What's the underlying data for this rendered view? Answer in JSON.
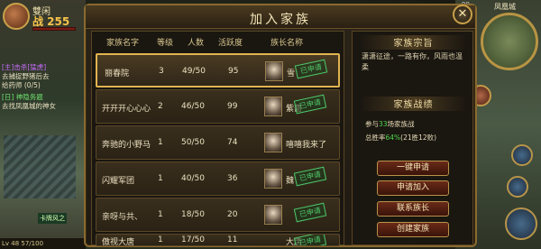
{
  "hud": {
    "player_name": "雙闲",
    "power": "战 255",
    "quests": [
      {
        "line1": "[主]击杀[猛虎]",
        "line2": "去捕捉野猪后去",
        "line3": "给药师 (0/5)"
      },
      {
        "line1": "[日] 神隐务题",
        "line2": "去找凤凰城的神女",
        "line3": ""
      }
    ],
    "bottom_tag": "卡牌风之",
    "level_text": "Lv 48  57/100"
  },
  "map": {
    "name": "凤凰城",
    "top_stat": "99"
  },
  "dialog": {
    "title": "加入家族",
    "close_label": "✕",
    "table": {
      "headers": [
        "家族名字",
        "等级",
        "人数",
        "活跃度",
        "族长名称"
      ],
      "rows": [
        {
          "name": "丽春院",
          "level": "3",
          "members": "49/50",
          "activity": "95",
          "leader": "雪",
          "applied": "已申请",
          "selected": true
        },
        {
          "name": "开开开心心心",
          "level": "2",
          "members": "46/50",
          "activity": "99",
          "leader": "紫蔷",
          "applied": "已申请",
          "selected": false
        },
        {
          "name": "奔驰的小野马",
          "level": "1",
          "members": "50/50",
          "activity": "74",
          "leader": "嘻嘻我来了",
          "applied": "",
          "selected": false
        },
        {
          "name": "闪耀军团",
          "level": "1",
          "members": "40/50",
          "activity": "36",
          "leader": "魏",
          "applied": "已申请",
          "selected": false
        },
        {
          "name": "亲呀与共、",
          "level": "1",
          "members": "18/50",
          "activity": "20",
          "leader": "",
          "applied": "已申请",
          "selected": false
        },
        {
          "name": "傲视大唐",
          "level": "1",
          "members": "17/50",
          "activity": "11",
          "leader": "大唐",
          "applied": "已申请",
          "selected": false
        }
      ]
    },
    "info": {
      "purpose_title": "家族宗旨",
      "purpose_text": "潇潇征途，一路有你，风雨也温柔",
      "war_title": "家族战绩",
      "war_line1_pre": "参与",
      "war_line1_num": "33",
      "war_line1_post": "场家族战",
      "war_line2_pre": "总胜率",
      "war_line2_num": "64%",
      "war_line2_post": "(21胜12败)"
    },
    "buttons": {
      "quick_apply": "一键申请",
      "apply": "申请加入",
      "contact": "联系族长",
      "create": "创建家族"
    }
  }
}
